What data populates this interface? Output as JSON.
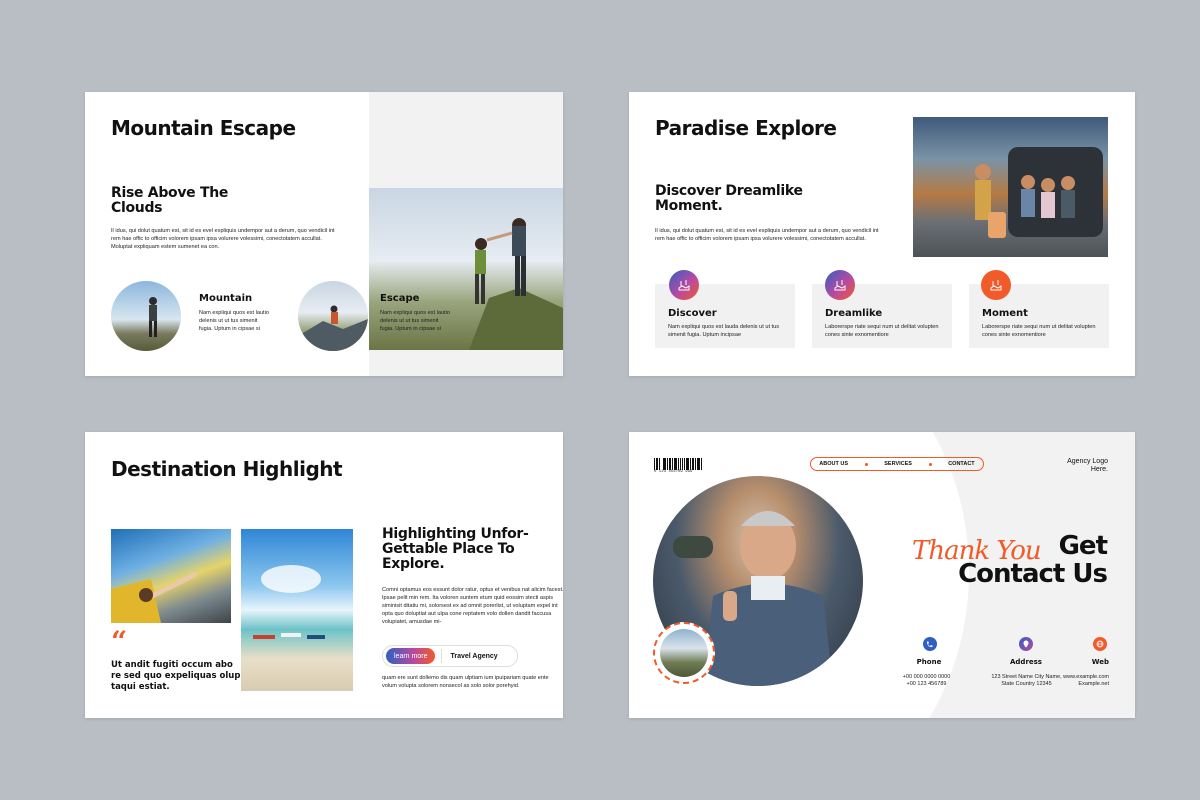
{
  "colors": {
    "accent": "#f15a29",
    "blue": "#2f5fc4",
    "magenta": "#b74aa0",
    "background": "#b9bec4"
  },
  "slide1": {
    "title": "Mountain Escape",
    "subtitle_line1": "Rise Above The",
    "subtitle_line2": "Clouds",
    "body": "Il idus, qui dolut quatum est, sit id es evel expliquis undempor aut a derum, quo vendicil int rem hae offic to officim volorem ipsam ipsa volurere volessimi, conectotatem accullat. Moluptat expliquam estem sumenet ea con.",
    "items": [
      {
        "title": "Mountain",
        "text": "Nam expliqui quos est lautio delenis ut ut tus simenit fugia. Uptum in cipsae si"
      },
      {
        "title": "Escape",
        "text": "Nam expliqui quos est lautio delenis ut ut tus simenit fugia. Uptum in cipsae si"
      }
    ]
  },
  "slide2": {
    "title": "Paradise Explore",
    "subtitle_line1": "Discover Dreamlike",
    "subtitle_line2": "Moment.",
    "body": "Il idus, qui dolut quatum est, sit id es evel expliquis undempor aut a derum, quo vendicil int rem hae offic to officim volorem ipsam ipsa volurere volessimi, conectotatem accullat.",
    "cards": [
      {
        "title": "Discover",
        "text": "Nam expliqui quos est lauda delenis ut ut tus simenit fugia. Uptum incipsae",
        "icon": "map-icon"
      },
      {
        "title": "Dreamlike",
        "text": "Laborerspe riate sequi num ut delitat volupten cones sinte exnomentiore",
        "icon": "map-icon"
      },
      {
        "title": "Moment",
        "text": "Laborerspe riate sequi num ut delitat volupten cones sinte exnomentiore",
        "icon": "map-icon"
      }
    ]
  },
  "slide3": {
    "title": "Destination Highlight",
    "quote_mark": "“",
    "quote": "Ut andit fugiti occum abo re sed quo expeliquas olup taqui estiat.",
    "heading_line1": "Highlighting Unfor-",
    "heading_line2": "Gettable Place To",
    "heading_line3": "Explore.",
    "body": "Comni optamus eos essunt dolor ratur, optus et venibus nat alicim facest. Ipsae pelit min rem. Ita voloren suntem etum quid eossim stecti aspis siminisit ditatiu mi, solorsest ex ad omnit porerlist, ut voluptam expel int opta quo doluptiat aut ulpa cone reptatem volo dollen dandit faccusa volupiatet, amusdae mi-",
    "button_label": "learn more",
    "tag_label": "Travel Agency",
    "footer_text": "quam ere sunt dollemo dis quam ulptiam ium ipuipariam quate ente volum volupta solorem nonsecol as solo solor porehyid."
  },
  "slide4": {
    "barcode_number": "0 123 456789 999",
    "nav": [
      "ABOUT US",
      "SERVICES",
      "CONTACT"
    ],
    "agency_logo_line1": "Agency Logo",
    "agency_logo_line2": "Here.",
    "script_text": "Thank You",
    "heading_line1": "Get",
    "heading_line2": "Contact Us",
    "contacts": [
      {
        "label": "Phone",
        "line1": "+00 000 0000 0000",
        "line2": "+00 123 456789",
        "icon": "phone-icon"
      },
      {
        "label": "Address",
        "line1": "123 Street Name City Name,",
        "line2": "State Country 12345",
        "icon": "location-icon"
      },
      {
        "label": "Web",
        "line1": "www.example.com",
        "line2": "Example.net",
        "icon": "globe-icon"
      }
    ]
  }
}
